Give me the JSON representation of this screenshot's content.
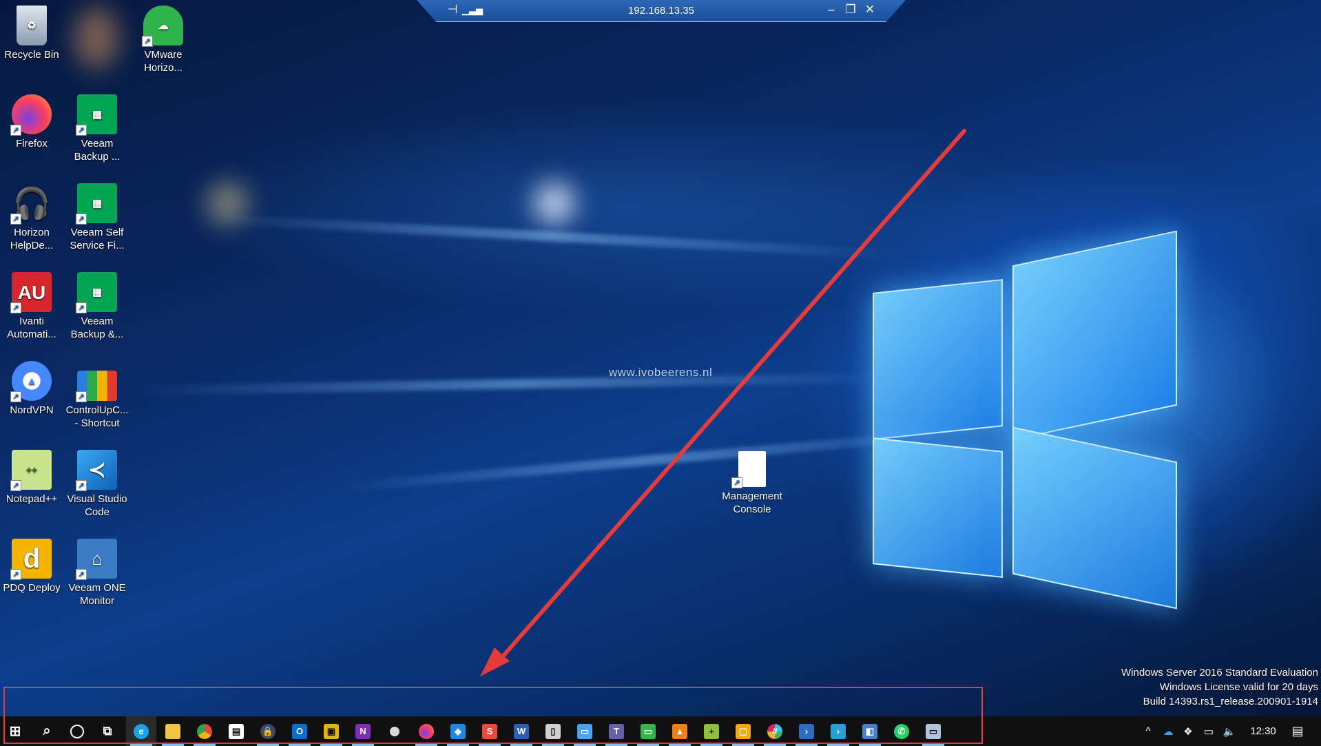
{
  "connection_bar": {
    "host": "192.168.13.35",
    "pin_icon": "pin-icon",
    "signal_icon": "signal-icon"
  },
  "watermark": "www.ivobeerens.nl",
  "desktop_icons": [
    {
      "label": "Recycle Bin",
      "icon": "recycle-bin-icon",
      "color": "#9aa7b5"
    },
    {
      "label": "VMware\nHorizo...",
      "icon": "vmware-horizon-icon",
      "color": "#2fb34a"
    },
    {
      "label": "Firefox",
      "icon": "firefox-icon",
      "color": "#ff6d1f"
    },
    {
      "label": "Veeam\nBackup ...",
      "icon": "veeam-icon",
      "color": "#00a651"
    },
    {
      "label": "Horizon\nHelpDe...",
      "icon": "headset-icon",
      "color": "#2fb34a"
    },
    {
      "label": "Veeam Self\nService Fi...",
      "icon": "veeam-icon",
      "color": "#00a651"
    },
    {
      "label": "Ivanti\nAutomati...",
      "icon": "ivanti-au-icon",
      "color": "#d9262c"
    },
    {
      "label": "Veeam\nBackup &...",
      "icon": "veeam-icon",
      "color": "#00a651"
    },
    {
      "label": "NordVPN",
      "icon": "nordvpn-icon",
      "color": "#4687ff"
    },
    {
      "label": "ControlUpC...\n- Shortcut",
      "icon": "controlup-icon",
      "color": "#e23b2e"
    },
    {
      "label": "Notepad++",
      "icon": "notepadpp-icon",
      "color": "#90c03a"
    },
    {
      "label": "Visual Studio\nCode",
      "icon": "vscode-icon",
      "color": "#23a9f2"
    },
    {
      "label": "PDQ Deploy",
      "icon": "pdq-deploy-icon",
      "color": "#f5b400"
    },
    {
      "label": "Veeam ONE\nMonitor",
      "icon": "veeam-one-icon",
      "color": "#3b7dc4"
    },
    {
      "label": "Management\nConsole",
      "icon": "document-icon",
      "color": "#ffffff"
    }
  ],
  "icon_glyphs": {
    "ivanti": "AU",
    "pdq": "d"
  },
  "system_info": {
    "line1": "Windows Server 2016 Standard Evaluation",
    "line2": "Windows License valid for 20 days",
    "line3": "Build 14393.rs1_release.200901-1914"
  },
  "taskbar": {
    "pinned": [
      {
        "name": "start-button",
        "icon": "windows-logo-icon",
        "color": "#ffffff"
      },
      {
        "name": "search-button",
        "icon": "search-icon",
        "color": "#ffffff"
      },
      {
        "name": "cortana-button",
        "icon": "cortana-circle-icon",
        "color": "#ffffff"
      },
      {
        "name": "task-view-button",
        "icon": "task-view-icon",
        "color": "#ffffff"
      },
      {
        "name": "taskbar-edge",
        "icon": "edge-icon",
        "color": "#1aa3e8"
      },
      {
        "name": "taskbar-file-explorer",
        "icon": "folder-icon",
        "color": "#f4c542"
      },
      {
        "name": "taskbar-chrome",
        "icon": "chrome-icon",
        "color": "#e8453c"
      },
      {
        "name": "taskbar-store",
        "icon": "store-icon",
        "color": "#ffffff"
      },
      {
        "name": "taskbar-password-manager",
        "icon": "lock-icon",
        "color": "#3b4a6b"
      },
      {
        "name": "taskbar-outlook",
        "icon": "outlook-icon",
        "color": "#0a6ecf"
      },
      {
        "name": "taskbar-sticky-app",
        "icon": "yellow-app-icon",
        "color": "#e0b700"
      },
      {
        "name": "taskbar-onenote",
        "icon": "onenote-icon",
        "color": "#7b2fb5"
      },
      {
        "name": "taskbar-chrome-alt",
        "icon": "chrome-icon",
        "color": "#d9d9d9"
      },
      {
        "name": "taskbar-firefox",
        "icon": "firefox-icon",
        "color": "#ff6d1f"
      },
      {
        "name": "taskbar-virtualbox",
        "icon": "cube-icon",
        "color": "#1e88e5"
      },
      {
        "name": "taskbar-s-app",
        "icon": "s-app-icon",
        "color": "#e84a3c"
      },
      {
        "name": "taskbar-word",
        "icon": "word-icon",
        "color": "#2b5fb4"
      },
      {
        "name": "taskbar-terminal",
        "icon": "terminal-icon",
        "color": "#d0d0d0"
      },
      {
        "name": "taskbar-remote-desktop",
        "icon": "monitor-icon",
        "color": "#4aa3f0"
      },
      {
        "name": "taskbar-teams",
        "icon": "teams-icon",
        "color": "#6264a7"
      },
      {
        "name": "taskbar-horizon",
        "icon": "green-screen-icon",
        "color": "#35b44a"
      },
      {
        "name": "taskbar-orange-app",
        "icon": "orange-app-icon",
        "color": "#f07f18"
      },
      {
        "name": "taskbar-notepadpp",
        "icon": "notepadpp-icon",
        "color": "#90c03a"
      },
      {
        "name": "taskbar-orange-box",
        "icon": "box-icon",
        "color": "#f3a712"
      },
      {
        "name": "taskbar-slack",
        "icon": "slack-icon",
        "color": "#e01e5a"
      },
      {
        "name": "taskbar-powershell",
        "icon": "powershell-icon",
        "color": "#2b6cc4"
      },
      {
        "name": "taskbar-powershell-ise",
        "icon": "powershell-ise-icon",
        "color": "#2aa0d8"
      },
      {
        "name": "taskbar-network-app",
        "icon": "network-icon",
        "color": "#4a7fd4"
      },
      {
        "name": "taskbar-whatsapp",
        "icon": "whatsapp-icon",
        "color": "#25d366"
      },
      {
        "name": "taskbar-rdp",
        "icon": "remote-monitor-icon",
        "color": "#b0c4de"
      }
    ],
    "tray": {
      "chevron": "^",
      "onedrive_icon": "cloud-icon",
      "dropbox_icon": "dropbox-icon",
      "battery_icon": "battery-icon",
      "volume_icon": "volume-icon",
      "clock": "12:30",
      "notifications_icon": "action-center-icon"
    }
  }
}
